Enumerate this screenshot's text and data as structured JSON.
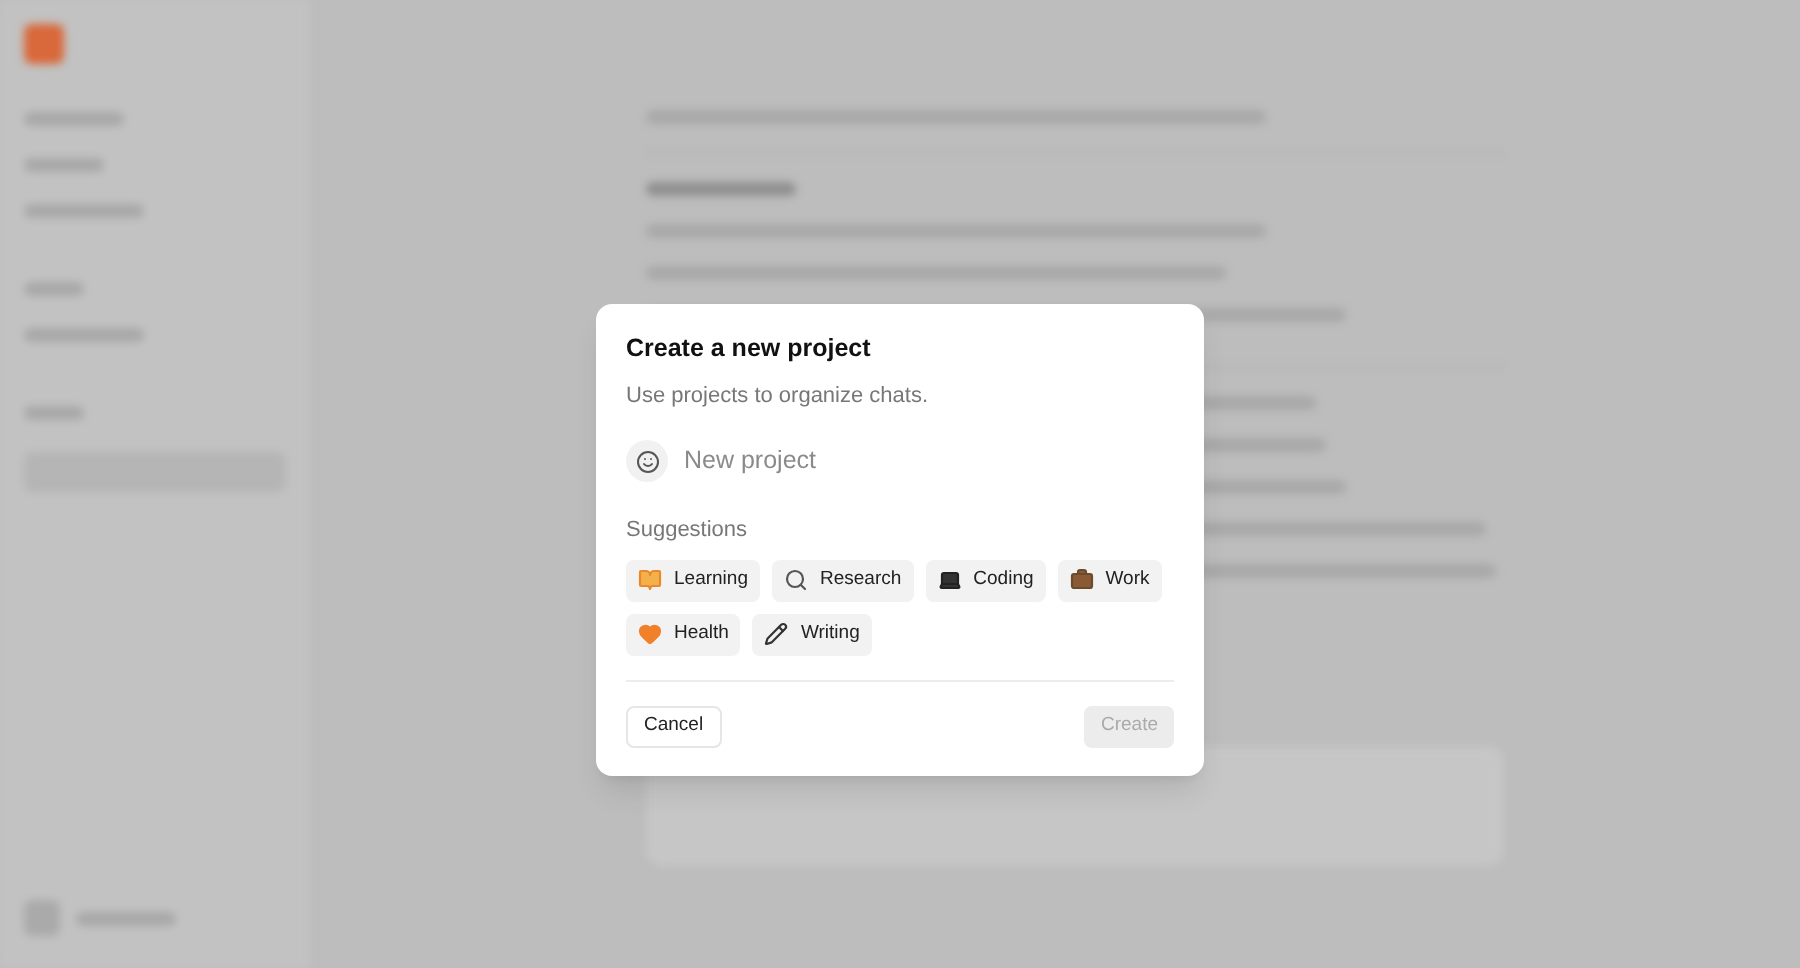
{
  "dialog": {
    "title": "Create a new project",
    "subtitle": "Use projects to organize chats.",
    "name_field": {
      "placeholder": "New project"
    },
    "suggestions_label": "Suggestions",
    "suggestions": [
      {
        "label": "Learning",
        "kind": "book"
      },
      {
        "label": "Research",
        "kind": "magnifier"
      },
      {
        "label": "Coding",
        "kind": "laptop"
      },
      {
        "label": "Work",
        "kind": "briefcase"
      },
      {
        "label": "Health",
        "kind": "heart"
      },
      {
        "label": "Writing",
        "kind": "pencil"
      }
    ],
    "cancel": "Cancel",
    "create": {
      "label": "Create",
      "disabled": true
    }
  }
}
